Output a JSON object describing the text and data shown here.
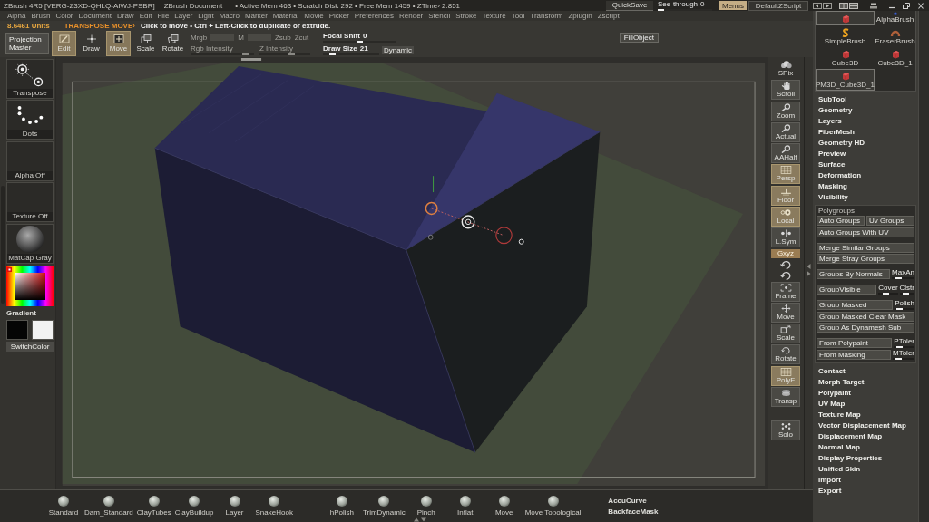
{
  "title_bar": {
    "app_title": "ZBrush 4R5 [VERG-Z3XD-QHLQ-AIWJ-PSBR]",
    "document": "ZBrush Document",
    "stats": "• Active Mem 463 • Scratch Disk 292 • Free Mem 1459 • ZTime› 2.851",
    "quicksave": "QuickSave",
    "see_through": {
      "label": "See-through",
      "value": "0",
      "level": 0
    },
    "menus": {
      "label": "Menus",
      "on": true
    },
    "script": "DefaultZScript"
  },
  "menu_bar": [
    "Alpha",
    "Brush",
    "Color",
    "Document",
    "Draw",
    "Edit",
    "File",
    "Layer",
    "Light",
    "Macro",
    "Marker",
    "Material",
    "Movie",
    "Picker",
    "Preferences",
    "Render",
    "Stencil",
    "Stroke",
    "Texture",
    "Tool",
    "Transform",
    "Zplugin",
    "Zscript"
  ],
  "info_line": {
    "units": "8.6461 Units",
    "action": "TRANSPOSE MOVE›",
    "hint": "Click to move • Ctrl + Left-Click to duplicate or extrude."
  },
  "top_shelf": {
    "projection_master": "Projection Master",
    "modes": [
      {
        "kind": "edit",
        "label": "Edit",
        "selected": true
      },
      {
        "kind": "draw",
        "label": "Draw",
        "selected": false
      },
      {
        "kind": "move",
        "label": "Move",
        "selected": true
      },
      {
        "kind": "scale",
        "label": "Scale",
        "selected": false
      },
      {
        "kind": "rotate",
        "label": "Rotate",
        "selected": false
      }
    ],
    "paint_modes": [
      {
        "kind": "text",
        "label": "Mrgb",
        "disabled": true
      },
      {
        "kind": "box",
        "disabled": true
      },
      {
        "kind": "text",
        "label": "M",
        "disabled": true
      },
      {
        "kind": "box",
        "disabled": true
      },
      {
        "kind": "text",
        "label": "Zsub",
        "disabled": true
      },
      {
        "kind": "text",
        "label": "Zcut",
        "disabled": true
      }
    ],
    "intensity": [
      {
        "label": "Rgb Intensity",
        "disabled": true,
        "level": 0.9
      },
      {
        "label": "Z Intensity",
        "disabled": true,
        "level": 0.65
      }
    ],
    "focal_shift": {
      "label": "Focal Shift",
      "value": "0",
      "level": 0.5
    },
    "draw_size": {
      "label": "Draw Size",
      "value": "21",
      "level": 0.12
    },
    "dynamic": "Dynamic",
    "fill_object": "FillObject"
  },
  "left_shelf": {
    "tiles": [
      {
        "kind": "transpose",
        "label": "Transpose"
      },
      {
        "kind": "dots",
        "label": "Dots"
      },
      {
        "kind": "empty",
        "label": "Alpha Off"
      },
      {
        "kind": "empty",
        "label": "Texture Off"
      },
      {
        "kind": "material",
        "label": "MatCap Gray"
      }
    ],
    "gradient": "Gradient",
    "swatches": [
      {
        "color": "#050505"
      },
      {
        "color": "#f2f2f2"
      }
    ],
    "switch_color": "SwitchColor"
  },
  "right_shelf": [
    {
      "kind": "spix",
      "label": "SPix",
      "on": false
    },
    {
      "kind": "scroll",
      "label": "Scroll",
      "on": false
    },
    {
      "kind": "zoom",
      "label": "Zoom",
      "on": false
    },
    {
      "kind": "actual",
      "label": "Actual",
      "on": false
    },
    {
      "kind": "aahalf",
      "label": "AAHalf",
      "on": false
    },
    {
      "kind": "persp",
      "label": "Persp",
      "on": true
    },
    {
      "kind": "floor",
      "label": "Floor",
      "on": true
    },
    {
      "kind": "local",
      "label": "Local",
      "on": true
    },
    {
      "kind": "lsym",
      "label": "L.Sym",
      "on": false
    },
    {
      "kind": "xyz",
      "label": "Gxyz",
      "on": true
    },
    {
      "kind": "orbit",
      "on": false
    },
    {
      "kind": "orbit",
      "on": false
    },
    {
      "kind": "frame",
      "label": "Frame",
      "on": false
    },
    {
      "kind": "move",
      "label": "Move",
      "on": false
    },
    {
      "kind": "scale",
      "label": "Scale",
      "on": false
    },
    {
      "kind": "rotate",
      "label": "Rotate",
      "on": false
    },
    {
      "kind": "polyf",
      "label": "PolyF",
      "on": true
    },
    {
      "kind": "transp",
      "label": "Transp",
      "on": false
    },
    {
      "kind": "solo",
      "label": "Solo",
      "on": false
    }
  ],
  "tool_palette": {
    "brushes": [
      {
        "kind": "cube",
        "selected": true
      },
      {
        "kind": "alpha",
        "label": "AlphaBrush",
        "selected": false
      },
      {
        "kind": "simple",
        "label": "SimpleBrush",
        "selected": false
      },
      {
        "kind": "eraser",
        "label": "EraserBrush",
        "selected": false
      },
      {
        "kind": "cube",
        "label": "Cube3D",
        "selected": false
      },
      {
        "kind": "cube",
        "label": "Cube3D_1",
        "selected": false
      },
      {
        "kind": "cube",
        "label": "PM3D_Cube3D_1",
        "selected": true
      }
    ],
    "sections_top": [
      "SubTool",
      "Geometry",
      "Layers",
      "FiberMesh",
      "Geometry HD",
      "Preview",
      "Surface",
      "Deformation",
      "Masking",
      "Visibility"
    ],
    "polygroups": {
      "title": "Polygroups",
      "expanded": true,
      "groups": [
        [
          [
            {
              "kind": "button",
              "label": "Auto Groups"
            },
            {
              "kind": "button",
              "label": "Uv Groups"
            }
          ],
          [
            {
              "kind": "button",
              "label": "Auto Groups With UV"
            }
          ]
        ],
        [
          [
            {
              "kind": "button",
              "label": "Merge Similar Groups"
            }
          ],
          [
            {
              "kind": "button",
              "label": "Merge Stray Groups"
            }
          ]
        ],
        [
          [
            {
              "kind": "button",
              "label": "Groups By Normals"
            },
            {
              "kind": "slider",
              "label": "MaxAn",
              "level": 0.2
            }
          ]
        ],
        [
          [
            {
              "kind": "button",
              "label": "GroupVisible"
            },
            {
              "kind": "slider",
              "label": "Cover",
              "level": 0.3
            },
            {
              "kind": "slider",
              "label": "Clstr",
              "level": 0.35
            }
          ]
        ],
        [
          [
            {
              "kind": "button",
              "label": "Group Masked"
            },
            {
              "kind": "slider",
              "label": "Polish",
              "level": 0.1
            }
          ],
          [
            {
              "kind": "button",
              "label": "Group Masked Clear Mask"
            }
          ],
          [
            {
              "kind": "button",
              "label": "Group As Dynamesh Sub"
            }
          ]
        ],
        [
          [
            {
              "kind": "button",
              "label": "From Polypaint"
            },
            {
              "kind": "slider",
              "label": "PToler",
              "level": 0.15
            }
          ],
          [
            {
              "kind": "button",
              "label": "From Masking"
            },
            {
              "kind": "slider",
              "label": "MToler",
              "level": 0.15
            }
          ]
        ]
      ]
    },
    "sections_bottom": [
      "Contact",
      "Morph Target",
      "Polypaint",
      "UV Map",
      "Texture Map",
      "Vector Displacement Map",
      "Displacement Map",
      "Normal Map",
      "Display Properties",
      "Unified Skin",
      "Import",
      "Export"
    ]
  },
  "bottom_shelf": {
    "brush_groups": [
      [
        "Standard",
        "Dam_Standard",
        "ClayTubes",
        "ClayBuildup",
        "Layer",
        "SnakeHook"
      ],
      [
        "hPolish",
        "TrimDynamic",
        "Pinch",
        "Inflat",
        "Move",
        "Move Topological"
      ]
    ],
    "toggles": [
      "AccuCurve",
      "BackfaceMask"
    ]
  }
}
